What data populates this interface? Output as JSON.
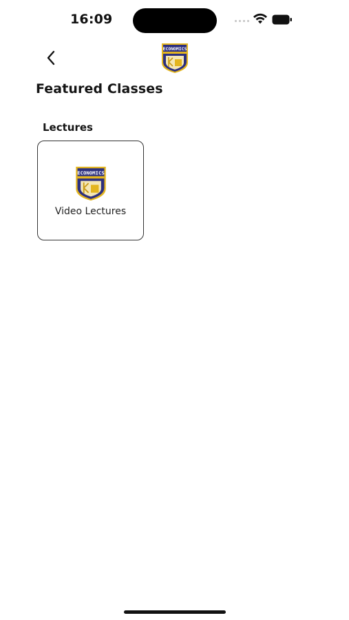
{
  "status_bar": {
    "time": "16:09"
  },
  "nav": {
    "back_icon": "chevron-left-icon",
    "logo_text": "ECONOMICS"
  },
  "page": {
    "title": "Featured Classes"
  },
  "sections": [
    {
      "heading": "Lectures",
      "cards": [
        {
          "label": "Video Lectures",
          "logo_text": "ECONOMICS",
          "icon": "economics-logo-icon"
        }
      ]
    }
  ],
  "colors": {
    "logo_blue": "#2c2f7f",
    "logo_gold": "#e3b520",
    "text": "#141414",
    "card_border": "#333333"
  }
}
